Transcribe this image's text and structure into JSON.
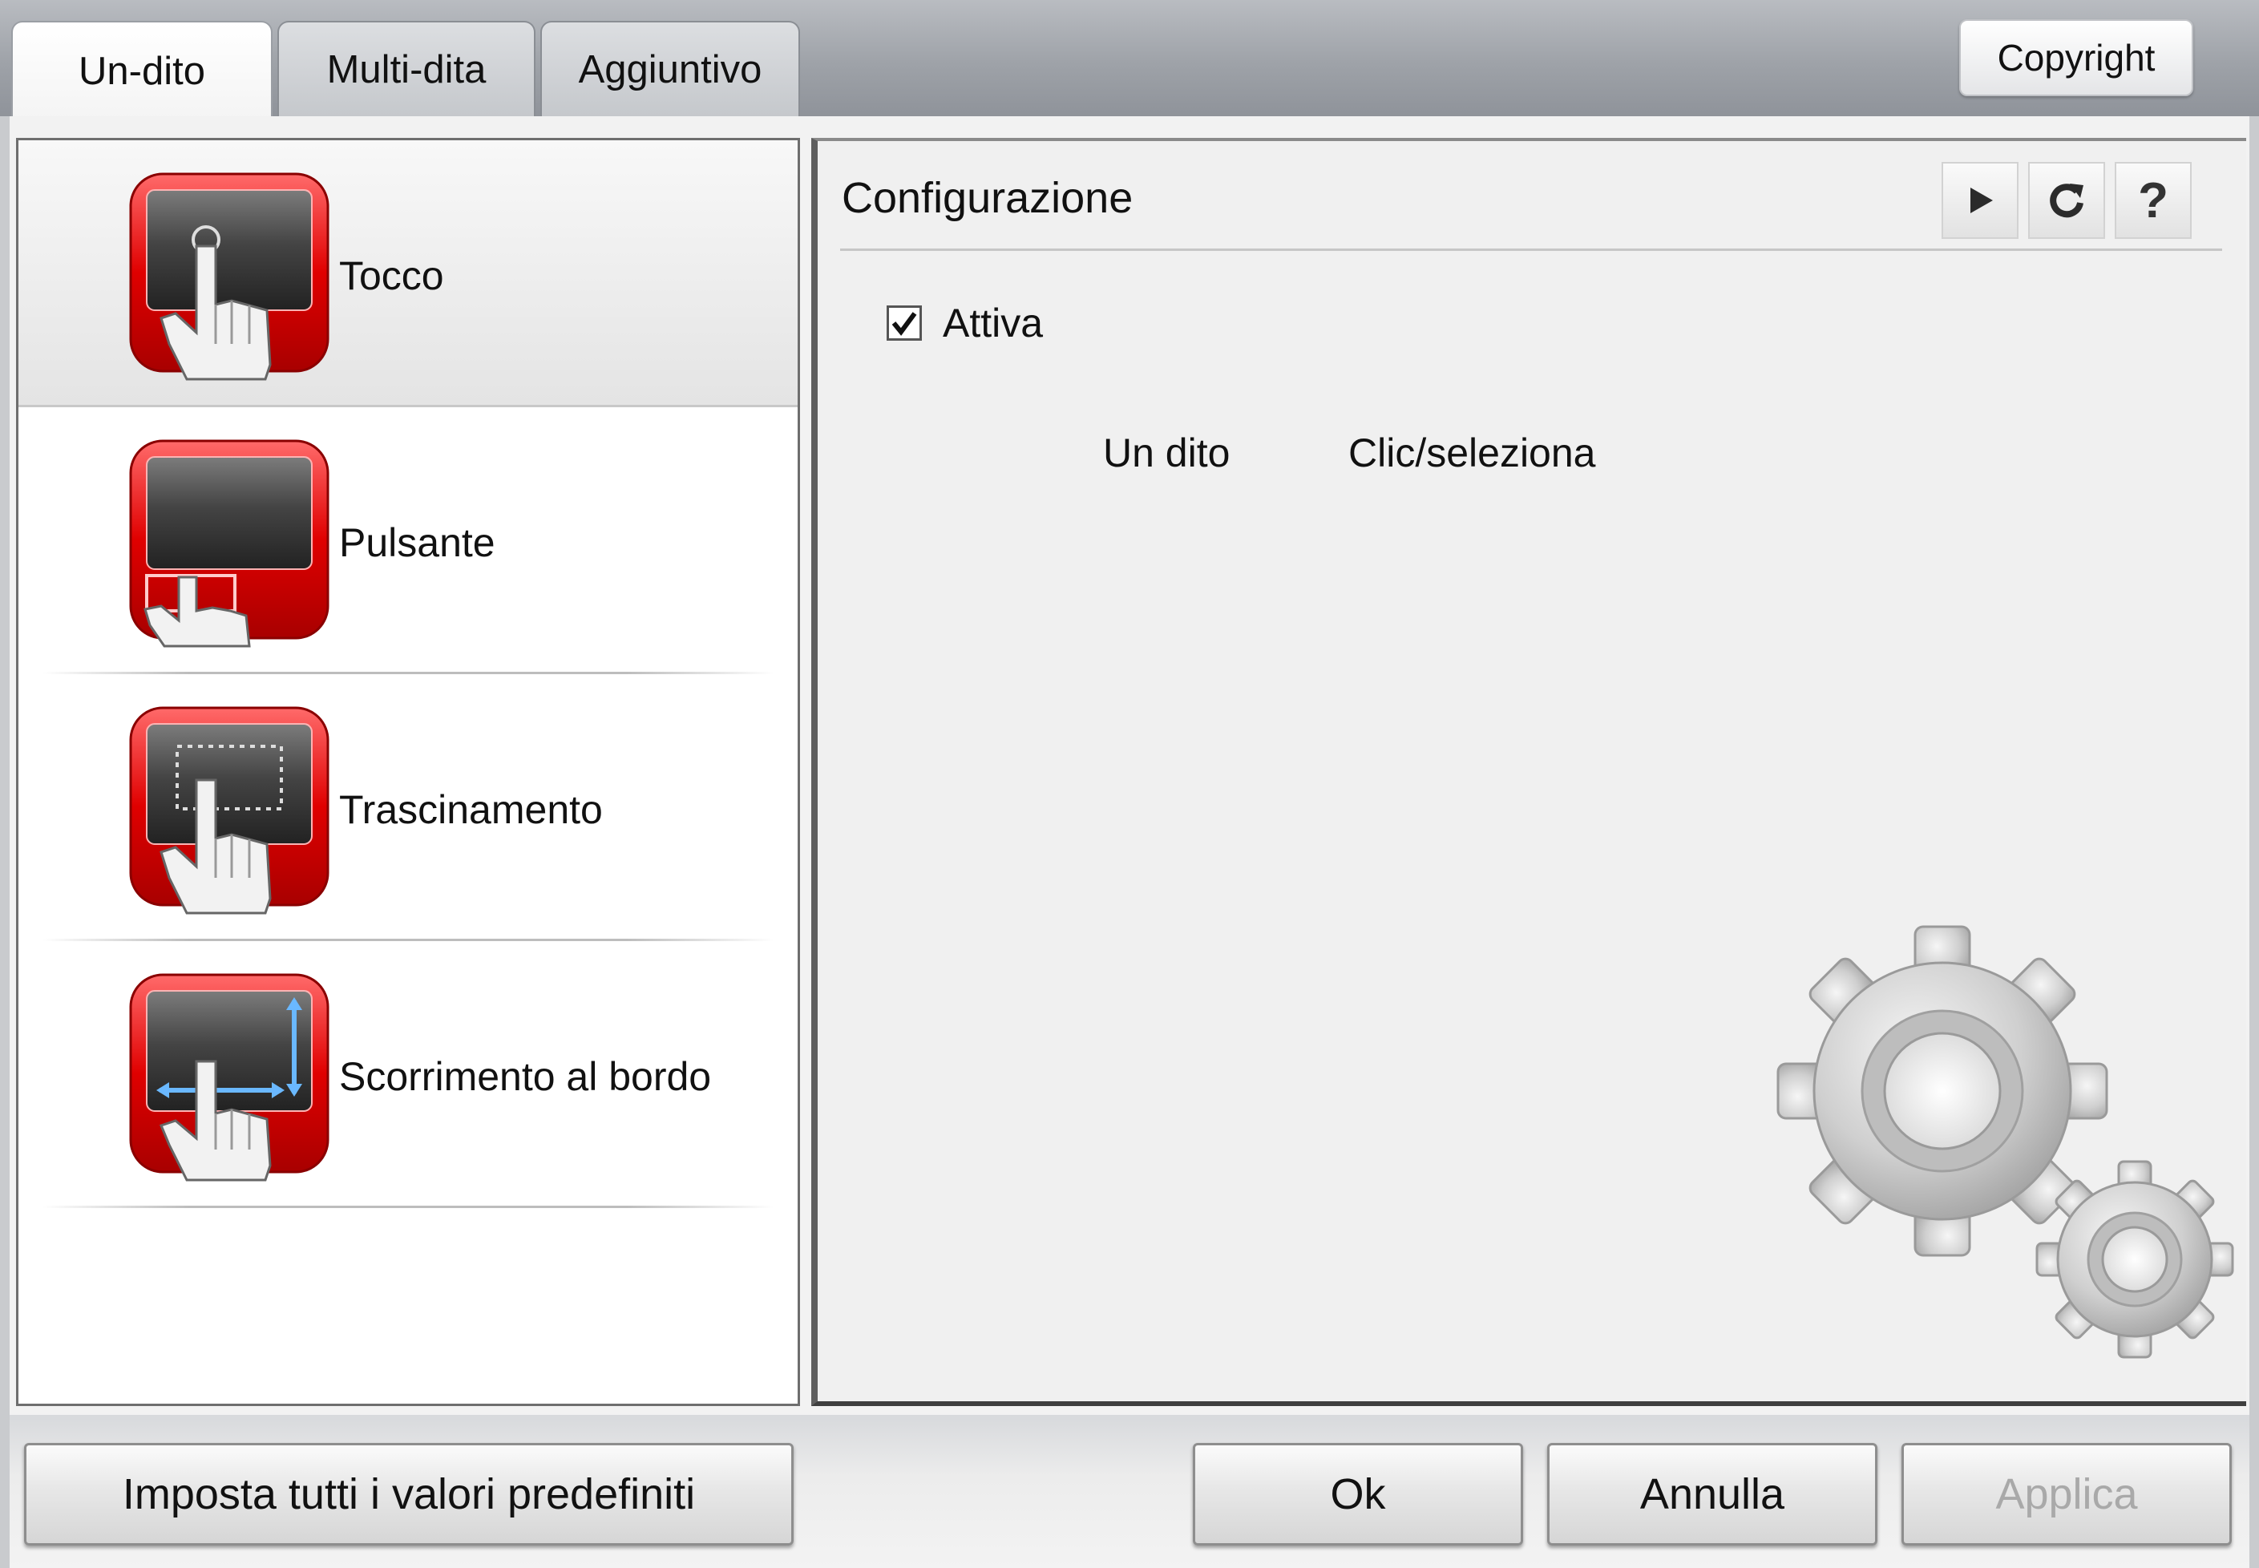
{
  "tabs": [
    {
      "label": "Un-dito",
      "active": true
    },
    {
      "label": "Multi-dita",
      "active": false
    },
    {
      "label": "Aggiuntivo",
      "active": false
    }
  ],
  "copyright_label": "Copyright",
  "gestures": [
    {
      "label": "Tocco",
      "icon": "tap-touchpad-icon",
      "selected": true
    },
    {
      "label": "Pulsante",
      "icon": "button-touchpad-icon",
      "selected": false
    },
    {
      "label": "Trascinamento",
      "icon": "drag-touchpad-icon",
      "selected": false
    },
    {
      "label": "Scorrimento al bordo",
      "icon": "edge-scroll-touchpad-icon",
      "selected": false
    }
  ],
  "config": {
    "title": "Configurazione",
    "toolbar": {
      "play_icon": "play-icon",
      "refresh_icon": "refresh-icon",
      "help_label": "?"
    },
    "enable_checkbox": {
      "label": "Attiva",
      "checked": true
    },
    "gesture_name": "Un dito",
    "gesture_action": "Clic/seleziona"
  },
  "buttons": {
    "defaults": "Imposta tutti i valori predefiniti",
    "ok": "Ok",
    "cancel": "Annulla",
    "apply": "Applica",
    "apply_enabled": false
  },
  "colors": {
    "icon_red": "#d40000",
    "tab_strip": "#9ea2a8",
    "disabled_text": "#a9a9a9"
  }
}
